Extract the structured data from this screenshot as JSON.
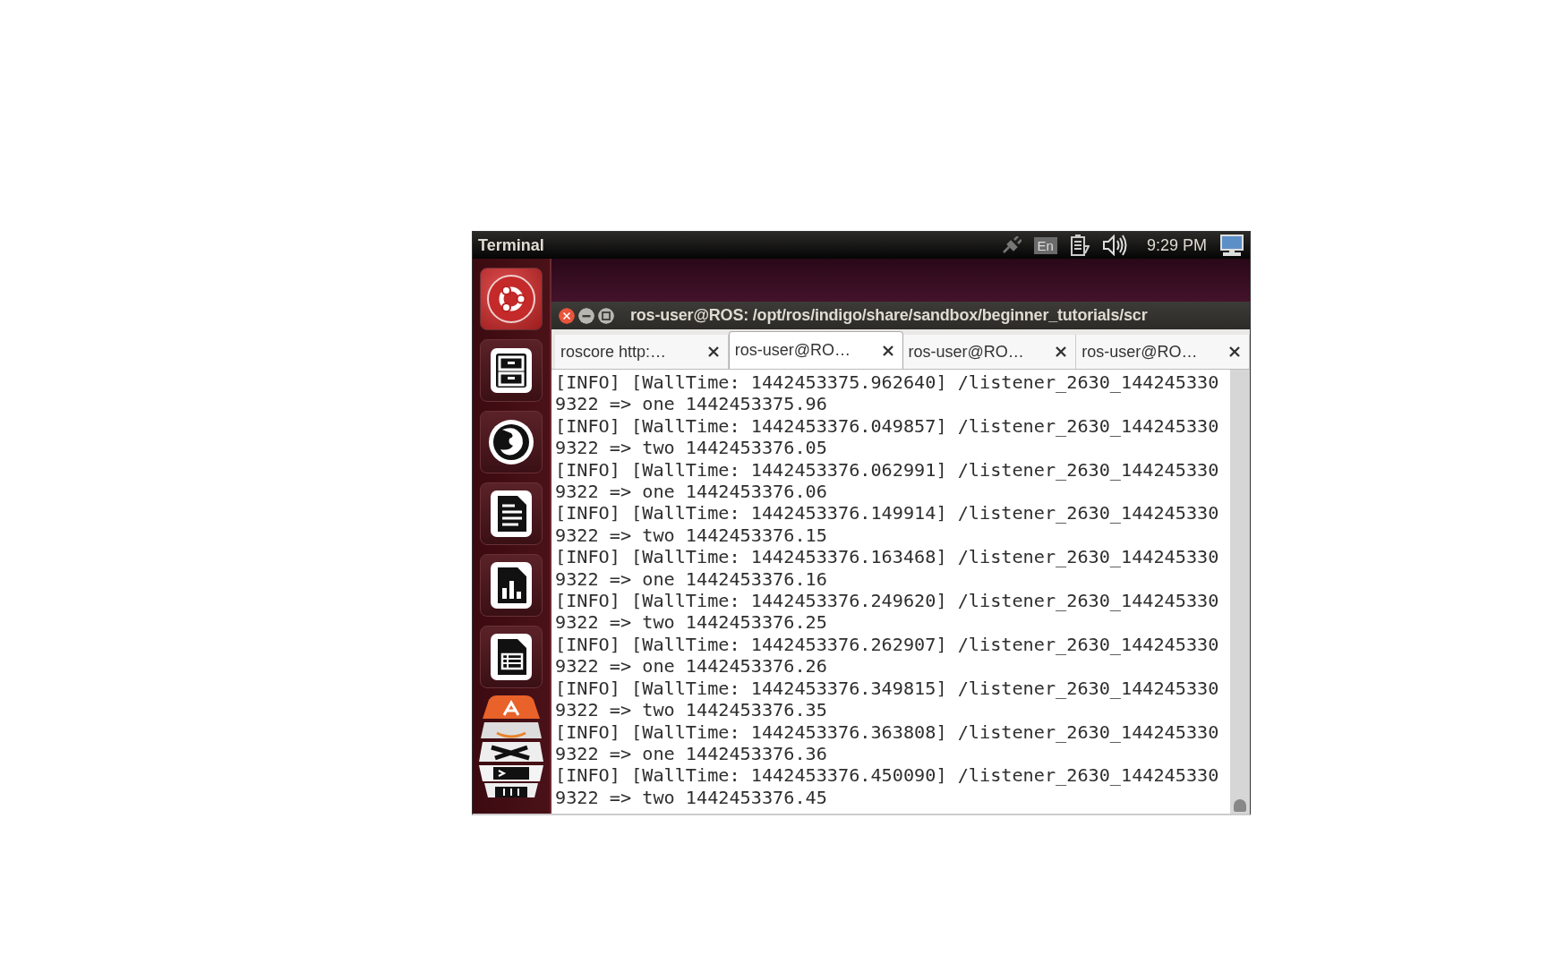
{
  "top_panel": {
    "app_name": "Terminal",
    "keyboard_layout": "En",
    "clock": "9:29 PM"
  },
  "launcher": {
    "items": [
      {
        "kind": "ubuntu"
      },
      {
        "kind": "files"
      },
      {
        "kind": "browser"
      },
      {
        "kind": "writer"
      },
      {
        "kind": "calc"
      },
      {
        "kind": "impress"
      },
      {
        "kind": "stack"
      }
    ]
  },
  "window": {
    "title": "ros-user@ROS: /opt/ros/indigo/share/sandbox/beginner_tutorials/scr",
    "tabs": [
      {
        "label": "roscore http:…",
        "selected": false
      },
      {
        "label": "ros-user@RO…",
        "selected": true
      },
      {
        "label": "ros-user@RO…",
        "selected": false
      },
      {
        "label": "ros-user@RO…",
        "selected": false
      }
    ],
    "lines": [
      "[INFO] [WallTime: 1442453375.962640] /listener_2630_144245330",
      "9322 => one 1442453375.96",
      "[INFO] [WallTime: 1442453376.049857] /listener_2630_144245330",
      "9322 => two 1442453376.05",
      "[INFO] [WallTime: 1442453376.062991] /listener_2630_144245330",
      "9322 => one 1442453376.06",
      "[INFO] [WallTime: 1442453376.149914] /listener_2630_144245330",
      "9322 => two 1442453376.15",
      "[INFO] [WallTime: 1442453376.163468] /listener_2630_144245330",
      "9322 => one 1442453376.16",
      "[INFO] [WallTime: 1442453376.249620] /listener_2630_144245330",
      "9322 => two 1442453376.25",
      "[INFO] [WallTime: 1442453376.262907] /listener_2630_144245330",
      "9322 => one 1442453376.26",
      "[INFO] [WallTime: 1442453376.349815] /listener_2630_144245330",
      "9322 => two 1442453376.35",
      "[INFO] [WallTime: 1442453376.363808] /listener_2630_144245330",
      "9322 => one 1442453376.36",
      "[INFO] [WallTime: 1442453376.450090] /listener_2630_144245330",
      "9322 => two 1442453376.45"
    ]
  }
}
